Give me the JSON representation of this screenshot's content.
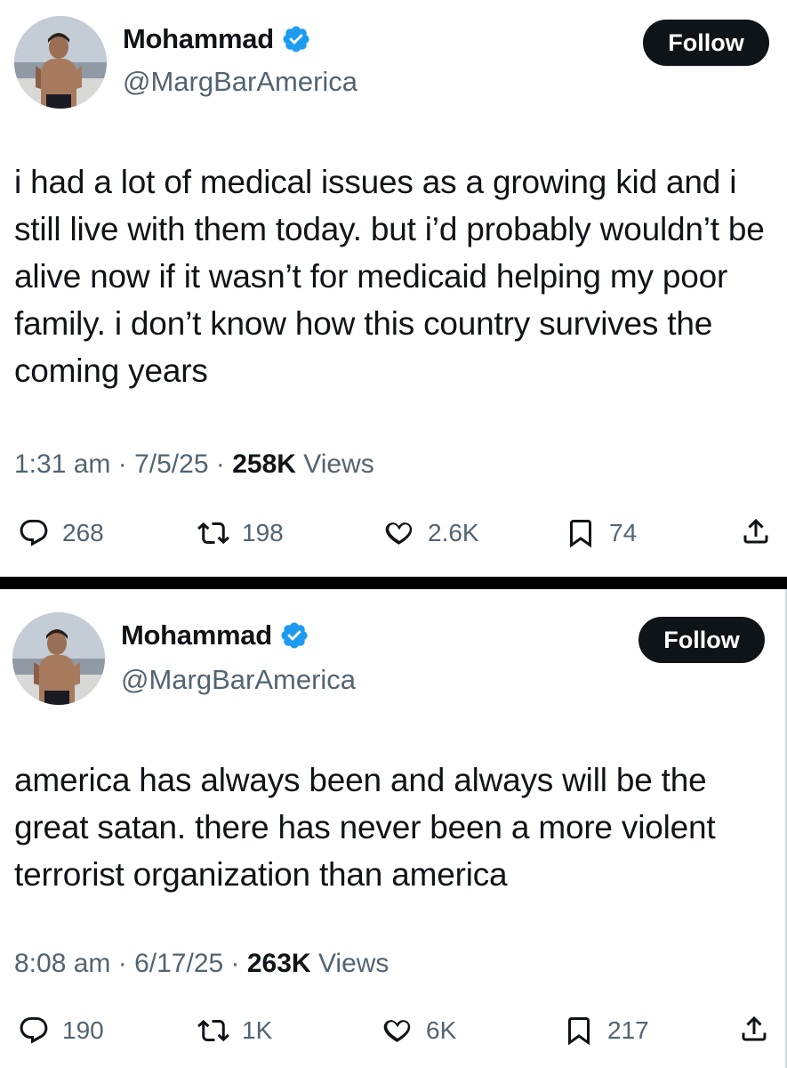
{
  "tweets": [
    {
      "author": {
        "name": "Mohammad",
        "handle": "@MargBarAmerica"
      },
      "follow_label": "Follow",
      "text": "i had a lot of medical issues as a growing kid and i still live with them today. but i’d probably wouldn’t be alive now if it wasn’t for medicaid helping my poor family. i don’t know how this country survives the coming years",
      "time": "1:31 am",
      "date": "7/5/25",
      "views_count": "258K",
      "views_label": "Views",
      "replies": "268",
      "reposts": "198",
      "likes": "2.6K",
      "bookmarks": "74"
    },
    {
      "author": {
        "name": "Mohammad",
        "handle": "@MargBarAmerica"
      },
      "follow_label": "Follow",
      "text": "america has always been and always will be the great satan. there has never been a more violent terrorist organization than america",
      "time": "8:08 am",
      "date": "6/17/25",
      "views_count": "263K",
      "views_label": "Views",
      "replies": "190",
      "reposts": "1K",
      "likes": "6K",
      "bookmarks": "217"
    }
  ],
  "meta_separator": "·",
  "colors": {
    "text": "#0f1419",
    "secondary": "#536471",
    "verified": "#1d9bf0",
    "button": "#0f1419"
  },
  "icons": [
    "verified-badge-icon",
    "reply-icon",
    "repost-icon",
    "like-icon",
    "bookmark-icon",
    "share-icon"
  ]
}
